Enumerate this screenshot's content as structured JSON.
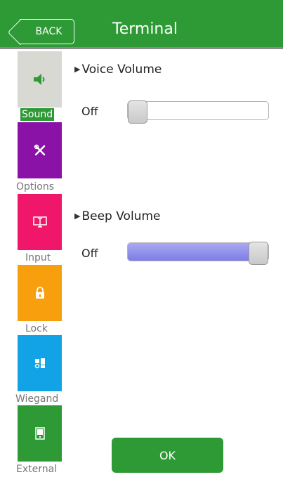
{
  "header": {
    "back_label": "BACK",
    "title": "Terminal"
  },
  "sidebar": {
    "items": [
      {
        "label": "Sound",
        "icon": "speaker-icon",
        "color": "#d9d9d4",
        "active": true
      },
      {
        "label": "Options",
        "icon": "tools-icon",
        "color": "#8a12a6",
        "active": false
      },
      {
        "label": "Input",
        "icon": "terminal-input-icon",
        "color": "#f0166a",
        "active": false
      },
      {
        "label": "Lock",
        "icon": "lock-icon",
        "color": "#f79f0d",
        "active": false
      },
      {
        "label": "Wiegand",
        "icon": "wiegand-icon",
        "color": "#11a3e6",
        "active": false
      },
      {
        "label": "External",
        "icon": "external-device-icon",
        "color": "#2e9a35",
        "active": false
      }
    ]
  },
  "voice_volume": {
    "title": "Voice Volume",
    "value_label": "Off",
    "level": 0.0
  },
  "beep_volume": {
    "title": "Beep Volume",
    "value_label": "Off",
    "level": 1.0
  },
  "ok_label": "OK",
  "colors": {
    "accent": "#2e9a35",
    "slider_fill": "#8c8ceb"
  }
}
